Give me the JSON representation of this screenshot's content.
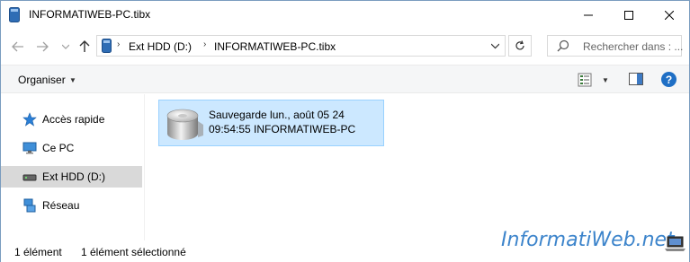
{
  "window": {
    "title": "INFORMATIWEB-PC.tibx"
  },
  "nav": {
    "breadcrumb": [
      "Ext HDD (D:)",
      "INFORMATIWEB-PC.tibx"
    ],
    "search_placeholder": "Rechercher dans : ..."
  },
  "toolbar": {
    "organise_label": "Organiser"
  },
  "sidebar": {
    "items": [
      {
        "label": "Accès rapide",
        "icon": "star-icon"
      },
      {
        "label": "Ce PC",
        "icon": "computer-icon"
      },
      {
        "label": "Ext HDD (D:)",
        "icon": "drive-icon",
        "selected": true
      },
      {
        "label": "Réseau",
        "icon": "network-icon"
      }
    ]
  },
  "files": [
    {
      "line1": "Sauvegarde lun., août 05 24",
      "line2": "09:54:55 INFORMATIWEB-PC",
      "icon": "backup-disk-icon",
      "selected": true
    }
  ],
  "status": {
    "count": "1 élément",
    "selection": "1 élément sélectionné"
  },
  "watermark": {
    "text": "InformatiWeb.net"
  },
  "colors": {
    "selection_bg": "#cce8ff",
    "selection_border": "#99d1ff",
    "accent": "#1f6fc5",
    "sidebar_selected": "#d9d9d9"
  }
}
